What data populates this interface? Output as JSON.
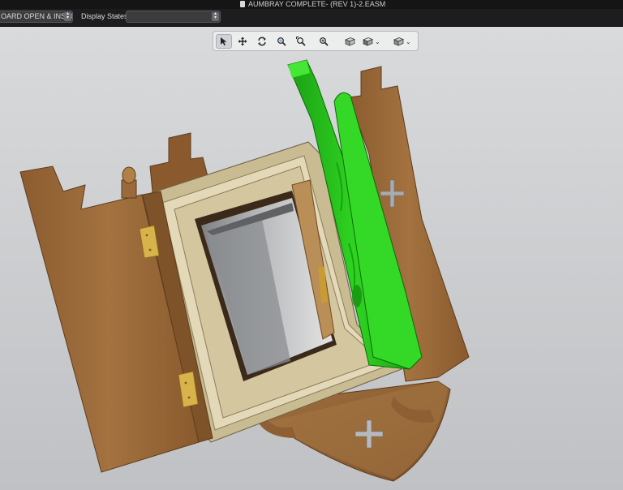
{
  "window": {
    "title": "AUMBRAY COMPLETE- (REV 1)-2.EASM"
  },
  "states_bar": {
    "configuration_value": "OARD OPEN & INSID...",
    "display_states_label": "Display States:",
    "display_states_value": ""
  },
  "toolbar": {
    "tools": [
      "select-icon",
      "pan-icon",
      "rotate-icon",
      "zoom-to-fit-icon",
      "zoom-to-area-icon",
      "zoom-icon",
      "view-orientation-icon",
      "display-style-icon",
      "section-view-icon"
    ],
    "active_tool": "select-icon"
  },
  "colors": {
    "viewport_top": "#d9dadc",
    "viewport_bottom": "#bfc1c4",
    "wood": "#9a6a3b",
    "light_wood": "#d9cda9",
    "highlight_green": "#27c51c"
  }
}
